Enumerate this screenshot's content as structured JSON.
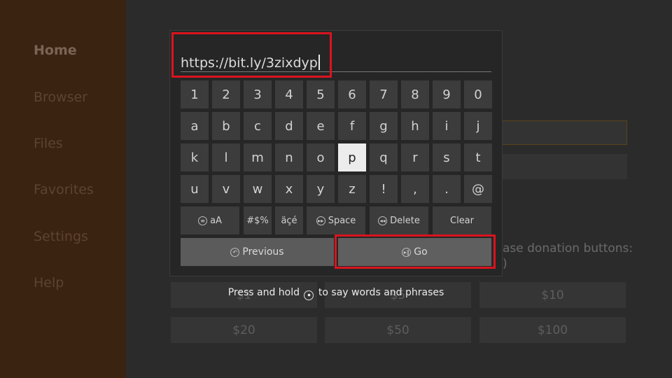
{
  "sidebar": {
    "items": [
      {
        "label": "Home"
      },
      {
        "label": "Browser"
      },
      {
        "label": "Files"
      },
      {
        "label": "Favorites"
      },
      {
        "label": "Settings"
      },
      {
        "label": "Help"
      }
    ]
  },
  "background": {
    "donation_text_line1": "ase donation buttons:",
    "donation_text_line2": ")",
    "donation_buttons": [
      "$1",
      "$5",
      "$10",
      "$20",
      "$50",
      "$100"
    ]
  },
  "keyboard": {
    "url_value": "https://bit.ly/3zixdyp",
    "rows": [
      [
        "1",
        "2",
        "3",
        "4",
        "5",
        "6",
        "7",
        "8",
        "9",
        "0"
      ],
      [
        "a",
        "b",
        "c",
        "d",
        "e",
        "f",
        "g",
        "h",
        "i",
        "j"
      ],
      [
        "k",
        "l",
        "m",
        "n",
        "o",
        "p",
        "q",
        "r",
        "s",
        "t"
      ],
      [
        "u",
        "v",
        "w",
        "x",
        "y",
        "z",
        "!",
        ",",
        ".",
        "@"
      ]
    ],
    "selected_key": "p",
    "function_keys": {
      "case_label": "aA",
      "symbols_label": "#$%",
      "accents_label": "äçé",
      "space_label": "Space",
      "delete_label": "Delete",
      "clear_label": "Clear"
    },
    "previous_label": "Previous",
    "go_label": "Go"
  },
  "hint": {
    "before": "Press and hold",
    "after": "to say words and phrases"
  },
  "colors": {
    "highlight": "#d9141f",
    "sidebar_bg": "#3b2312"
  }
}
